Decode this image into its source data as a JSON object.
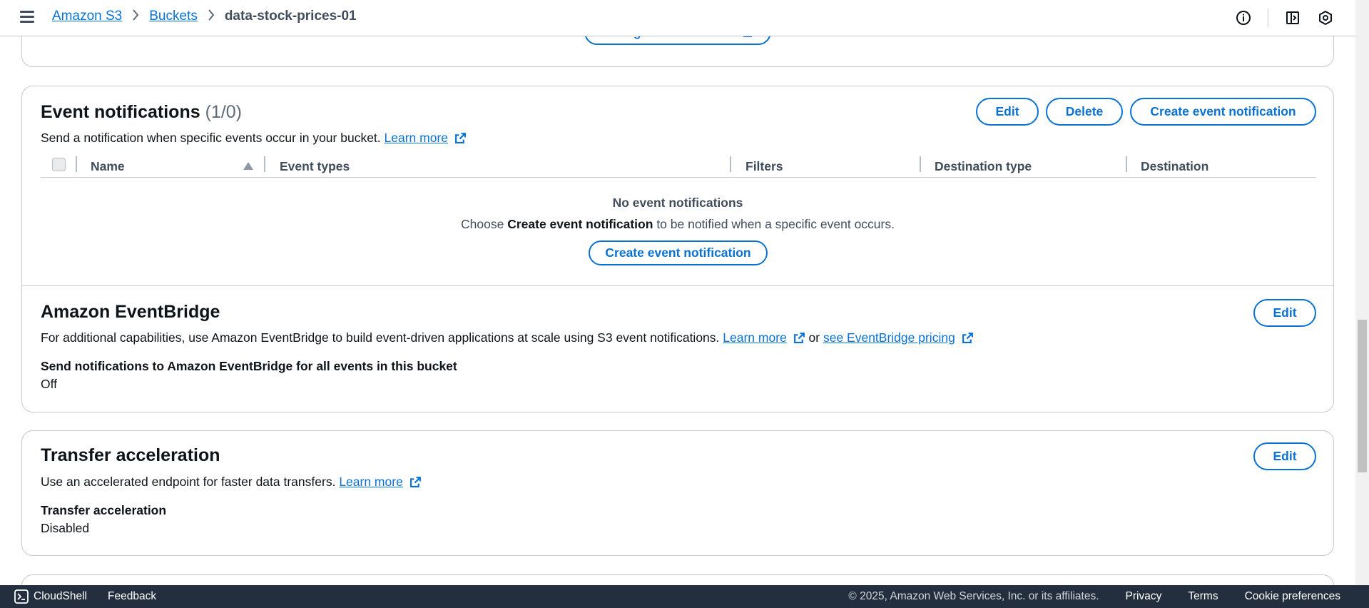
{
  "header": {
    "breadcrumbs": [
      "Amazon S3",
      "Buckets",
      "data-stock-prices-01"
    ],
    "icons": [
      "info-icon",
      "notifications-panel-icon",
      "settings-icon"
    ]
  },
  "top_card": {
    "button_label": "Configure in CloudTrail"
  },
  "event_notifications": {
    "title": "Event notifications",
    "count": "(1/0)",
    "description": "Send a notification when specific events occur in your bucket.",
    "learn_more": "Learn more",
    "buttons": {
      "edit": "Edit",
      "delete": "Delete",
      "create": "Create event notification"
    },
    "columns": [
      "Name",
      "Event types",
      "Filters",
      "Destination type",
      "Destination"
    ],
    "empty_title": "No event notifications",
    "empty_pre": "Choose",
    "empty_bold": "Create event notification",
    "empty_post": "to be notified when a specific event occurs.",
    "empty_button": "Create event notification"
  },
  "eventbridge": {
    "title": "Amazon EventBridge",
    "edit": "Edit",
    "description": "For additional capabilities, use Amazon EventBridge to build event-driven applications at scale using S3 event notifications.",
    "learn_more": "Learn more",
    "or": "or",
    "pricing_link": "see EventBridge pricing",
    "setting_label": "Send notifications to Amazon EventBridge for all events in this bucket",
    "setting_value": "Off"
  },
  "transfer_acceleration": {
    "title": "Transfer acceleration",
    "edit": "Edit",
    "description": "Use an accelerated endpoint for faster data transfers.",
    "learn_more": "Learn more",
    "setting_label": "Transfer acceleration",
    "setting_value": "Disabled"
  },
  "footer": {
    "cloudshell": "CloudShell",
    "feedback": "Feedback",
    "copyright": "© 2025, Amazon Web Services, Inc. or its affiliates.",
    "privacy": "Privacy",
    "terms": "Terms",
    "cookie": "Cookie preferences"
  },
  "colors": {
    "link": "#0972d3",
    "border": "#c6c6cd",
    "footer_bg": "#232f3e"
  }
}
